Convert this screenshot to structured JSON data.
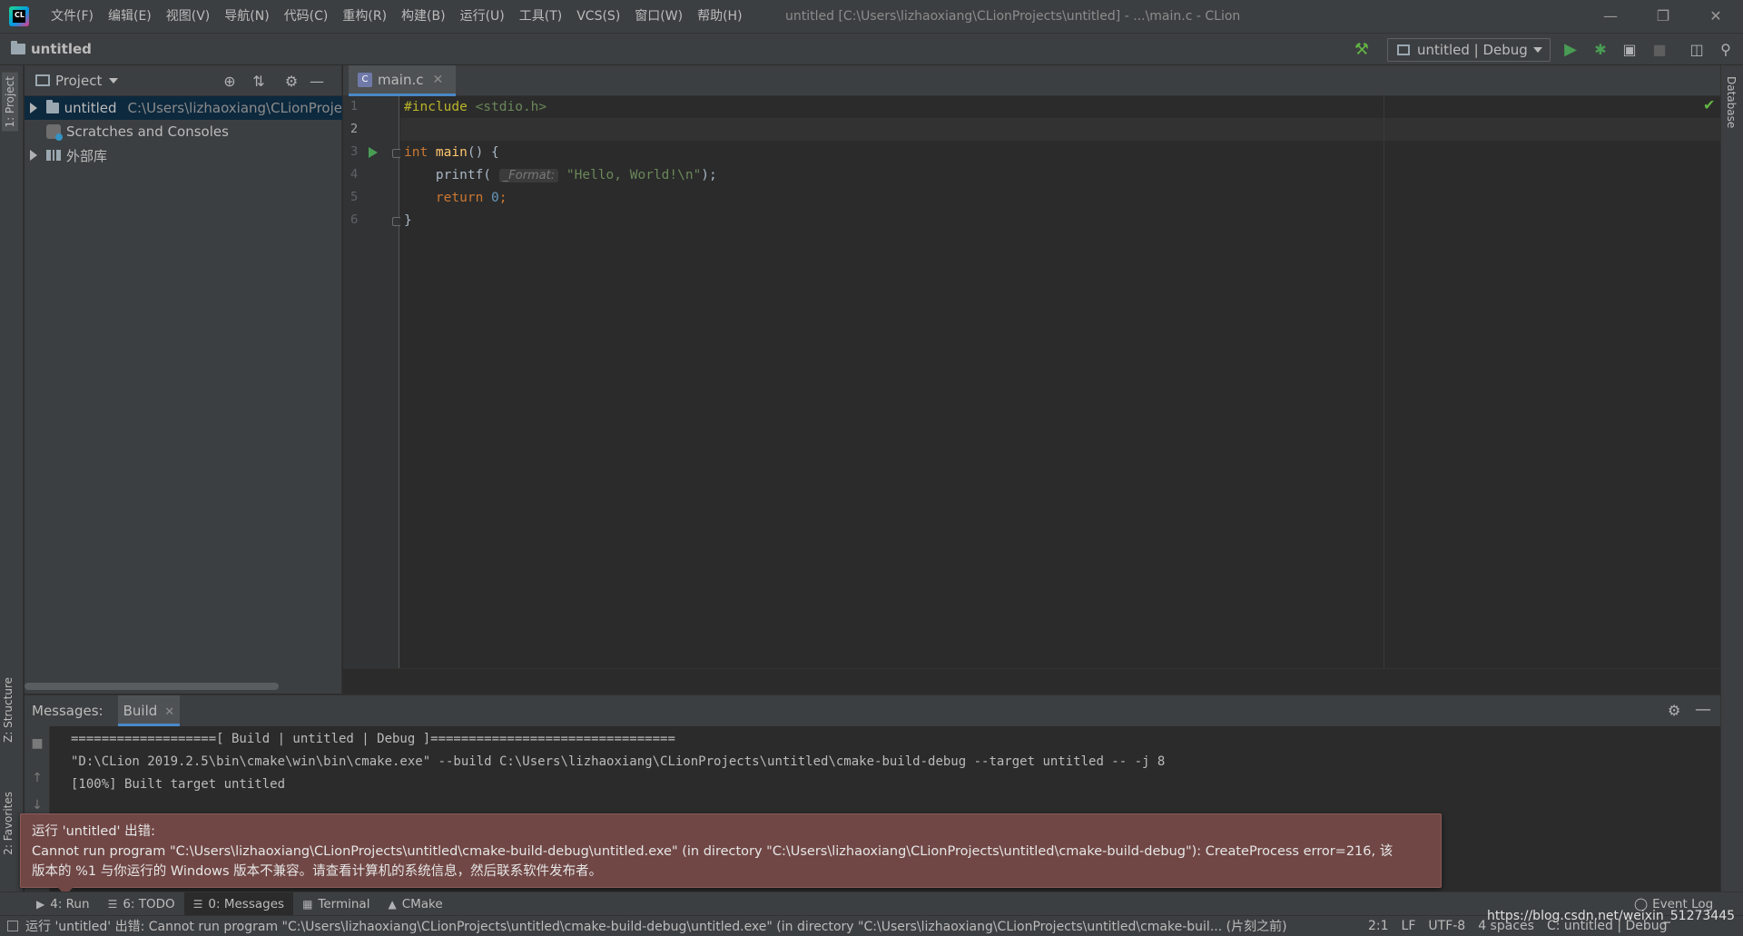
{
  "window": {
    "title": "untitled [C:\\Users\\lizhaoxiang\\CLionProjects\\untitled] - ...\\main.c - CLion",
    "menu": [
      "文件(F)",
      "编辑(E)",
      "视图(V)",
      "导航(N)",
      "代码(C)",
      "重构(R)",
      "构建(B)",
      "运行(U)",
      "工具(T)",
      "VCS(S)",
      "窗口(W)",
      "帮助(H)"
    ]
  },
  "navbar": {
    "breadcrumb": "untitled",
    "run_config": "untitled | Debug"
  },
  "side_tabs": {
    "project": "1: Project",
    "structure": "Z: Structure",
    "favorites": "2: Favorites",
    "database": "Database"
  },
  "project_panel": {
    "title": "Project",
    "tree": [
      {
        "label": "untitled",
        "path": "C:\\Users\\lizhaoxiang\\CLionProje",
        "selected": true
      },
      {
        "label": "Scratches and Consoles"
      },
      {
        "label": "外部库"
      }
    ]
  },
  "editor": {
    "tab": "main.c",
    "line_numbers": [
      "1",
      "2",
      "3",
      "4",
      "5",
      "6"
    ],
    "code": {
      "l1_directive": "#include",
      "l1_header": " <stdio.h>",
      "l3_type": "int",
      "l3_fn": " main",
      "l3_rest": "() {",
      "l4_fn": "    printf(",
      "l4_hint": "_Format:",
      "l4_str": "\"Hello, World!\\n\"",
      "l4_end": ");",
      "l5_kw": "    return",
      "l5_num": " 0",
      "l5_end": ";",
      "l6": "}"
    }
  },
  "messages": {
    "label": "Messages:",
    "tab": "Build",
    "output": [
      "===================[ Build | untitled | Debug ]================================",
      "\"D:\\CLion 2019.2.5\\bin\\cmake\\win\\bin\\cmake.exe\" --build C:\\Users\\lizhaoxiang\\CLionProjects\\untitled\\cmake-build-debug --target untitled -- -j 8",
      "[100%] Built target untitled"
    ]
  },
  "error_balloon": {
    "title": "运行 'untitled' 出错:",
    "line1": "Cannot run program \"C:\\Users\\lizhaoxiang\\CLionProjects\\untitled\\cmake-build-debug\\untitled.exe\" (in directory \"C:\\Users\\lizhaoxiang\\CLionProjects\\untitled\\cmake-build-debug\"): CreateProcess error=216, 该",
    "line2": "版本的 %1 与你运行的 Windows 版本不兼容。请查看计算机的系统信息，然后联系软件发布者。"
  },
  "bottom_tabs": [
    {
      "label": "4: Run"
    },
    {
      "label": "6: TODO"
    },
    {
      "label": "0: Messages",
      "active": true
    },
    {
      "label": "Terminal"
    },
    {
      "label": "CMake"
    }
  ],
  "event_log": "Event Log",
  "status": {
    "message": "运行 'untitled' 出错: Cannot run program \"C:\\Users\\lizhaoxiang\\CLionProjects\\untitled\\cmake-build-debug\\untitled.exe\" (in directory \"C:\\Users\\lizhaoxiang\\CLionProjects\\untitled\\cmake-buil... (片刻之前)",
    "position": "2:1",
    "line_ending": "LF",
    "encoding": "UTF-8",
    "indent": "4 spaces",
    "context": "C: untitled | Debug"
  },
  "watermark": "https://blog.csdn.net/weixin_51273445",
  "colors": {
    "accent": "#4a88c7",
    "run_green": "#499c54",
    "error_bg": "#704745"
  }
}
